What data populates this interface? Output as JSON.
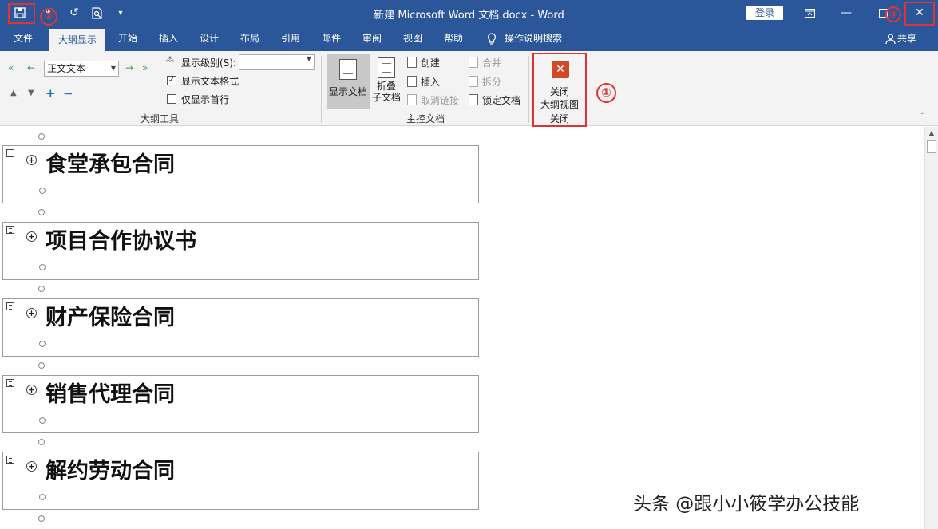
{
  "titlebar": {
    "title": "新建 Microsoft Word 文档.docx  -  Word",
    "login": "登录",
    "bg_color": "#2b579a"
  },
  "quick_access": {
    "save_icon": "save-icon",
    "undo_icon": "undo-icon",
    "redo_icon": "redo-icon",
    "preview_icon": "print-preview-icon",
    "customize_icon": "customize-qat-icon"
  },
  "tabs": [
    {
      "label": "文件"
    },
    {
      "label": "大纲显示",
      "active": true
    },
    {
      "label": "开始"
    },
    {
      "label": "插入"
    },
    {
      "label": "设计"
    },
    {
      "label": "布局"
    },
    {
      "label": "引用"
    },
    {
      "label": "邮件"
    },
    {
      "label": "审阅"
    },
    {
      "label": "视图"
    },
    {
      "label": "帮助"
    }
  ],
  "tell_me": "操作说明搜索",
  "share": "共享",
  "ribbon": {
    "outline_tools": {
      "level_value": "正文文本",
      "show_level_label": "显示级别(S):",
      "show_text_format": "显示文本格式",
      "show_text_format_checked": true,
      "show_first_line": "仅显示首行",
      "show_first_line_checked": false,
      "group_label": "大纲工具"
    },
    "master_doc": {
      "show_document": "显示文档",
      "collapse_line1": "折叠",
      "collapse_line2": "子文档",
      "create": "创建",
      "insert": "插入",
      "unlink": "取消链接",
      "merge": "合并",
      "split": "拆分",
      "lock": "锁定文档",
      "group_label": "主控文档"
    },
    "close": {
      "button_line1": "关闭",
      "button_line2": "大纲视图",
      "group_label": "关闭"
    }
  },
  "annotations": {
    "circle_1": "①",
    "circle_2": "②",
    "circle_3": "③"
  },
  "document": {
    "subdocs": [
      {
        "title": "食堂承包合同"
      },
      {
        "title": "项目合作协议书"
      },
      {
        "title": "财产保险合同"
      },
      {
        "title": "销售代理合同"
      },
      {
        "title": "解约劳动合同"
      }
    ]
  },
  "watermark": "头条 @跟小小筱学办公技能"
}
